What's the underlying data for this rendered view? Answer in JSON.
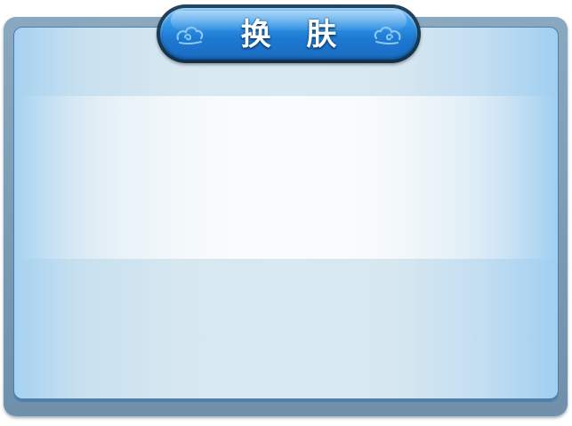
{
  "dialog": {
    "title": "换 肤",
    "icons": [
      "cloud-swirl-ornament",
      "cloud-swirl-ornament"
    ]
  }
}
